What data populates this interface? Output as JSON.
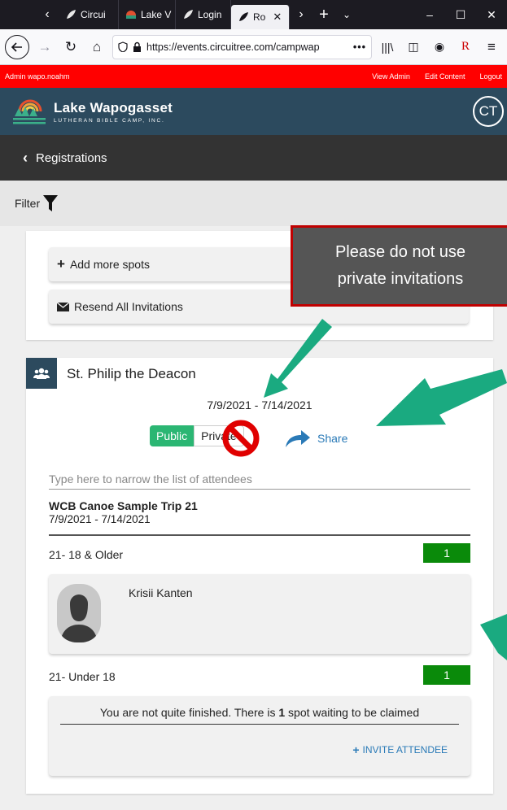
{
  "browser": {
    "tabs": [
      {
        "label": "Circui",
        "icon": "circuitree-icon"
      },
      {
        "label": "Lake V",
        "icon": "lake-logo-icon"
      },
      {
        "label": "Login",
        "icon": "circuitree-icon"
      },
      {
        "label": "Ro",
        "icon": "circuitree-icon",
        "active": true
      }
    ],
    "url": "https://events.circuitree.com/campwap"
  },
  "admin_bar": {
    "user": "Admin wapo.noahm",
    "links": [
      "View Admin",
      "Edit Content",
      "Logout"
    ]
  },
  "site": {
    "title": "Lake Wapogasset",
    "subtitle": "LUTHERAN BIBLE CAMP, INC.",
    "badge": "CT"
  },
  "nav": {
    "back_label": "Registrations"
  },
  "filter": {
    "label": "Filter"
  },
  "card": {
    "add_spots": "Add more spots",
    "resend": "Resend All Invitations"
  },
  "group": {
    "name": "St. Philip the Deacon",
    "dates": "7/9/2021 - 7/14/2021",
    "public_label": "Public",
    "private_label": "Private",
    "share_label": "Share",
    "search_placeholder": "Type here to narrow the list of attendees",
    "trip_name": "WCB Canoe Sample Trip 21",
    "trip_dates": "7/9/2021 - 7/14/2021",
    "categories": [
      {
        "label": "21- 18 & Older",
        "count": "1"
      },
      {
        "label": "21- Under 18",
        "count": "1"
      }
    ],
    "attendee": "Krisii Kanten",
    "waiting_pre": "You are not quite finished. There is ",
    "waiting_count": "1",
    "waiting_post": " spot waiting to be claimed",
    "invite_label": "INVITE ATTENDEE"
  },
  "annotation": {
    "line1": "Please do not use",
    "line2": "private invitations",
    "arrow_color": "#1aaa80",
    "border_color": "#c00000"
  }
}
